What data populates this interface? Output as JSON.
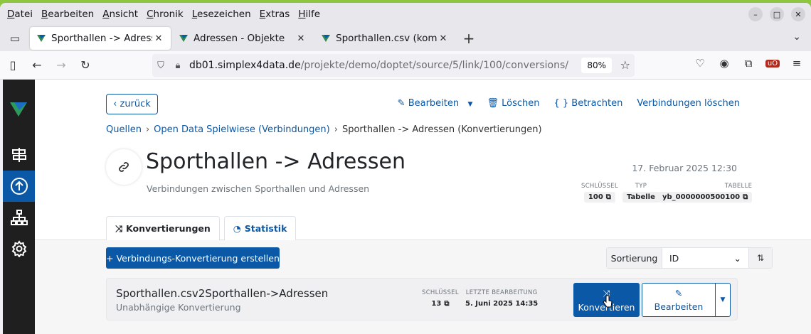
{
  "browser": {
    "menu": [
      "Datei",
      "Bearbeiten",
      "Ansicht",
      "Chronik",
      "Lesezeichen",
      "Extras",
      "Hilfe"
    ],
    "menu_access_keys": [
      "D",
      "B",
      "A",
      "C",
      "L",
      "E",
      "H"
    ],
    "tabs": [
      {
        "title": "Sporthallen -> Adressen (Konvertierungen)",
        "active": true
      },
      {
        "title": "Adressen - Objekte",
        "active": false
      },
      {
        "title": "Sporthallen.csv (komplett)",
        "active": false
      }
    ],
    "url": {
      "host": "db01.simplex4data.de",
      "path": "/projekte/demo/doptet/source/5/link/100/conversions/"
    },
    "zoom": "80%"
  },
  "header": {
    "back_label": "zurück",
    "actions": {
      "edit": "Bearbeiten",
      "delete": "Löschen",
      "view": "Betrachten",
      "delete_links": "Verbindungen löschen"
    }
  },
  "breadcrumb": [
    "Quellen",
    "Open Data Spielwiese (Verbindungen)",
    "Sporthallen -> Adressen (Konvertierungen)"
  ],
  "page": {
    "title": "Sporthallen -> Adressen",
    "subtitle": "Verbindungen zwischen Sporthallen und Adressen",
    "date": "17. Februar 2025 12:30",
    "meta": {
      "key_label": "SCHLÜSSEL",
      "key": "100",
      "type_label": "TYP",
      "type": "Tabelle",
      "table_label": "TABELLE",
      "table": "yb_0000000500100"
    }
  },
  "tabs": {
    "conversions": "Konvertierungen",
    "statistics": "Statistik"
  },
  "toolbar": {
    "create_label": "+ Verbindungs-Konvertierung erstellen",
    "sort_label": "Sortierung",
    "sort_value": "ID"
  },
  "items": [
    {
      "title": "Sporthallen.csv2Sporthallen->Adressen",
      "subtitle": "Unabhängige Konvertierung",
      "key_label": "SCHLÜSSEL",
      "key": "13",
      "edited_label": "LETZTE BEARBEITUNG",
      "edited": "5. Juni 2025 14:35",
      "convert_label": "Konvertieren",
      "edit_label": "Bearbeiten"
    }
  ],
  "colors": {
    "brand": "#0a58a6",
    "sidebar": "#1f1f1f",
    "desktop": "#8ec63f"
  }
}
